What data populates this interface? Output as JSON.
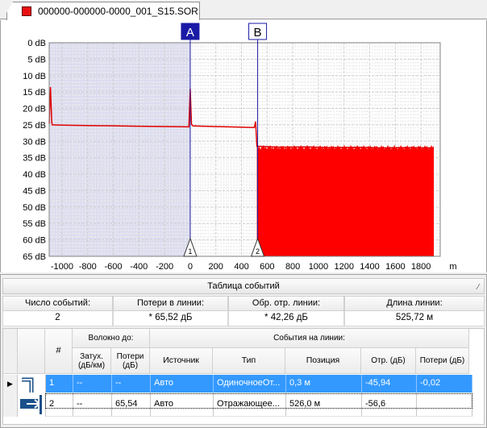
{
  "tab": {
    "title": "000000-000000-0000_001_S15.SOR",
    "color": "#e81010"
  },
  "chart_data": {
    "type": "line",
    "title": "",
    "xlabel": "",
    "x_unit": "m",
    "y_unit": "dB",
    "xlim": [
      -1100,
      1950
    ],
    "ylim": [
      0,
      65
    ],
    "y_inverted": true,
    "x_ticks": [
      -1000,
      -800,
      -600,
      -400,
      -200,
      0,
      200,
      400,
      600,
      800,
      1000,
      1200,
      1400,
      1600,
      1800
    ],
    "x_tick_labels": [
      "-1000",
      "-800",
      "-600",
      "-400",
      "-200",
      "0",
      "200",
      "400",
      "600",
      "800",
      "1000",
      "1200",
      "1400",
      "1600",
      "1800"
    ],
    "y_ticks": [
      0,
      5,
      10,
      15,
      20,
      25,
      30,
      35,
      40,
      45,
      50,
      55,
      60,
      65
    ],
    "y_tick_labels": [
      "0 dB",
      "5 dB",
      "10 dB",
      "15 dB",
      "20 dB",
      "25 dB",
      "30 dB",
      "35 dB",
      "40 dB",
      "45 dB",
      "50 dB",
      "55 dB",
      "60 dB",
      "65 dB"
    ],
    "grid": true,
    "trace_color": "#e00000",
    "shaded_region": {
      "x_from": -1100,
      "x_to": 0,
      "color": "#dcdcf0"
    },
    "series": [
      {
        "name": "",
        "points": [
          [
            -1100,
            24.6
          ],
          [
            -1090,
            13.5
          ],
          [
            -1080,
            24.3
          ],
          [
            -1075,
            25.0
          ],
          [
            -1000,
            25.1
          ],
          [
            -800,
            25.2
          ],
          [
            -600,
            25.3
          ],
          [
            -400,
            25.4
          ],
          [
            -200,
            25.5
          ],
          [
            -10,
            25.6
          ],
          [
            0,
            14.0
          ],
          [
            10,
            24.8
          ],
          [
            20,
            25.3
          ],
          [
            100,
            25.4
          ],
          [
            200,
            25.5
          ],
          [
            300,
            25.6
          ],
          [
            400,
            25.7
          ],
          [
            500,
            25.8
          ],
          [
            510,
            24.0
          ],
          [
            520,
            31.5
          ],
          [
            700,
            31.8
          ],
          [
            900,
            31.7
          ],
          [
            1100,
            31.9
          ],
          [
            1300,
            31.8
          ],
          [
            1500,
            32.0
          ],
          [
            1700,
            31.9
          ],
          [
            1900,
            32.0
          ]
        ]
      }
    ],
    "noise_fill": {
      "x_from": 520,
      "x_to": 1900,
      "y_top": 31.8,
      "color": "#ff0000"
    },
    "markers": [
      {
        "label": "A",
        "x": 0,
        "color": "#1a1aa6"
      },
      {
        "label": "B",
        "x": 526,
        "color": "#ffffff"
      }
    ],
    "event_flags": [
      {
        "label": "1",
        "x": 0
      },
      {
        "label": "2",
        "x": 526
      }
    ]
  },
  "events": {
    "title": "Таблица событий",
    "summary": [
      {
        "label": "Число событий:",
        "value": "2"
      },
      {
        "label": "Потери в линии:",
        "value": "* 65,52 дБ"
      },
      {
        "label": "Обр. отр. линии:",
        "value": "* 42,26 дБ"
      },
      {
        "label": "Длина линии:",
        "value": "525,72 м"
      }
    ],
    "group_headers": {
      "fiber": "Волокно до:",
      "line_events": "События на линии:"
    },
    "columns": {
      "num": "#",
      "atten": "Затух. (дБ/км)",
      "loss_fiber": "Потери (дБ)",
      "source": "Источник",
      "type": "Тип",
      "position": "Позиция",
      "refl": "Отр. (дБ)",
      "loss": "Потери (дБ)"
    },
    "rows": [
      {
        "num": "1",
        "atten": "--",
        "loss_fiber": "--",
        "source": "Авто",
        "type": "ОдиночноеОт...",
        "position": "0,3 м",
        "refl": "-45,94",
        "loss": "-0,02"
      },
      {
        "num": "2",
        "atten": "--",
        "loss_fiber": "65,54",
        "source": "Авто",
        "type": "Отражающее...",
        "position": "526,0 м",
        "refl": "-56,6",
        "loss": ""
      }
    ]
  }
}
